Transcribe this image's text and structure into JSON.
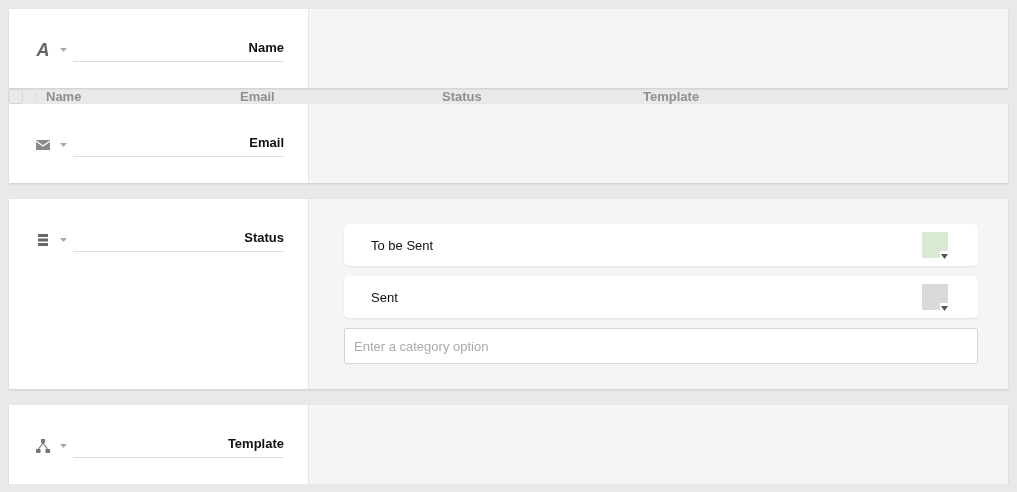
{
  "fields": [
    {
      "kind": "text",
      "glyph": "A",
      "label": "Name"
    },
    {
      "kind": "email",
      "label": "Email"
    },
    {
      "kind": "category",
      "label": "Status",
      "options": [
        {
          "label": "To be Sent",
          "color": "#d9ead3"
        },
        {
          "label": "Sent",
          "color": "#d9d9d9"
        }
      ],
      "new_option": {
        "placeholder": "Enter a category option"
      }
    },
    {
      "kind": "relation",
      "label": "Template"
    }
  ],
  "background_table": {
    "select_all_checked": false,
    "columns": [
      "Name",
      "Email",
      "Status",
      "Template"
    ]
  }
}
